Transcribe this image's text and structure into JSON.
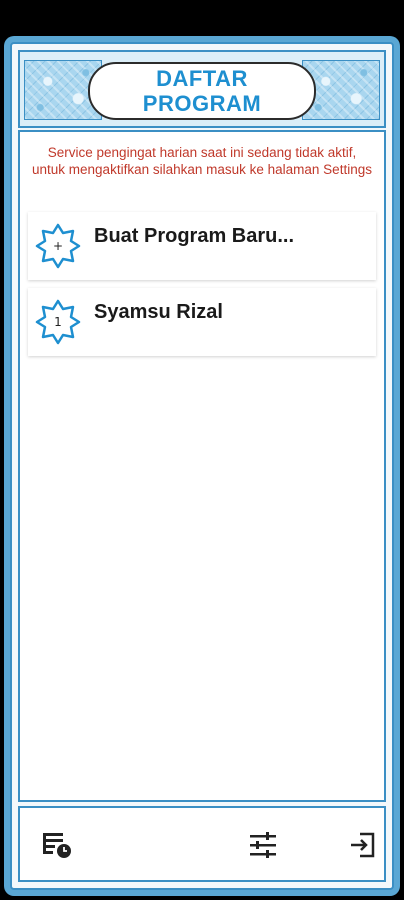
{
  "header": {
    "title_line1": "DAFTAR",
    "title_line2": "PROGRAM"
  },
  "notice": "Service pengingat harian saat ini sedang tidak aktif, untuk mengaktifkan silahkan masuk ke halaman Settings",
  "programs": [
    {
      "badge": "+",
      "label": "Buat Program Baru..."
    },
    {
      "badge": "1",
      "label": "Syamsu Rizal"
    }
  ],
  "footer": {
    "icons": [
      "schedule-list-icon",
      "sliders-icon",
      "logout-icon"
    ]
  },
  "colors": {
    "accent": "#1e8fd0",
    "frame": "#5aa7d4",
    "notice": "#c0392b"
  }
}
